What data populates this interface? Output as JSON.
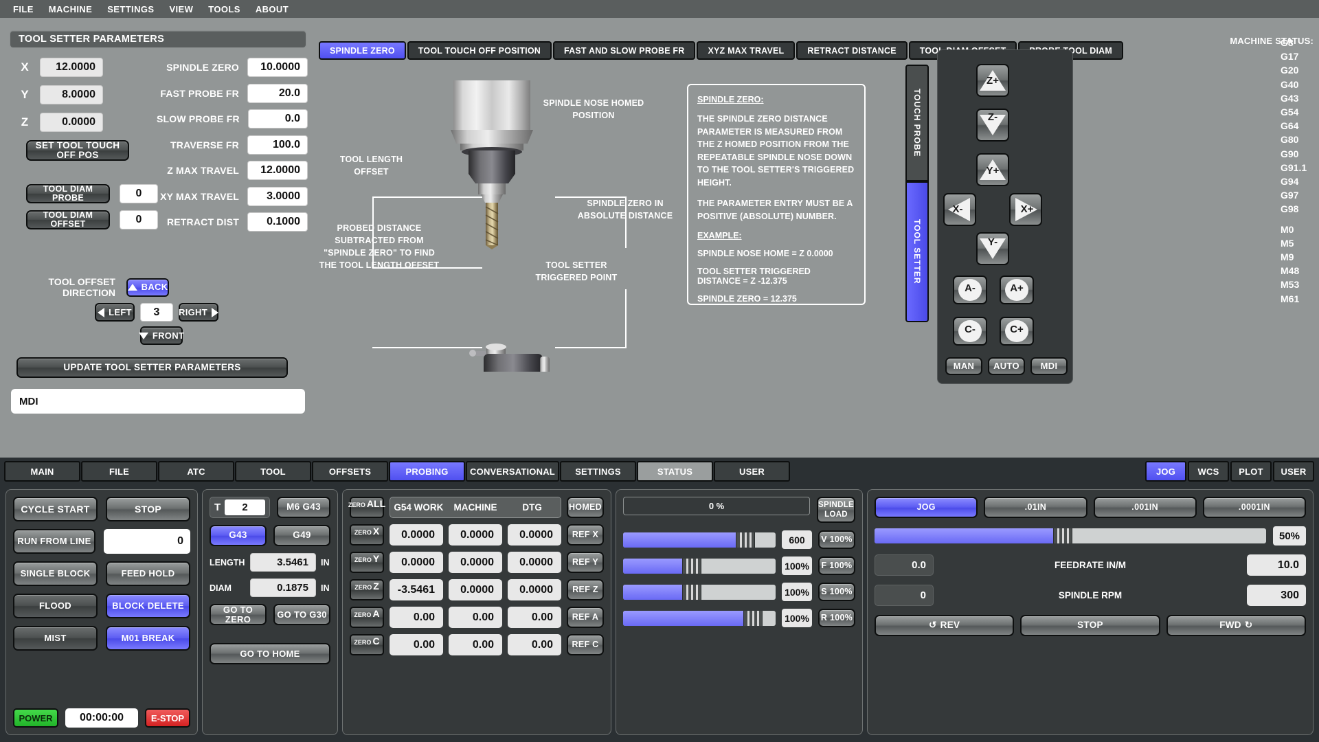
{
  "menubar": {
    "items": [
      "FILE",
      "MACHINE",
      "SETTINGS",
      "VIEW",
      "TOOLS",
      "ABOUT"
    ]
  },
  "left_panel": {
    "title": "TOOL SETTER PARAMETERS",
    "axes": [
      {
        "label": "X",
        "value": "12.0000"
      },
      {
        "label": "Y",
        "value": "8.0000"
      },
      {
        "label": "Z",
        "value": "0.0000"
      }
    ],
    "set_touch_off_label": "SET TOOL TOUCH OFF POS",
    "tool_diam_probe_label": "TOOL DIAM PROBE",
    "tool_diam_probe_value": "0",
    "tool_diam_offset_label": "TOOL DIAM OFFSET",
    "tool_diam_offset_value": "0",
    "params": [
      {
        "label": "SPINDLE ZERO",
        "value": "10.0000"
      },
      {
        "label": "FAST PROBE FR",
        "value": "20.0"
      },
      {
        "label": "SLOW PROBE FR",
        "value": "0.0"
      },
      {
        "label": "TRAVERSE FR",
        "value": "100.0"
      },
      {
        "label": "Z MAX TRAVEL",
        "value": "12.0000"
      },
      {
        "label": "XY MAX TRAVEL",
        "value": "3.0000"
      },
      {
        "label": "RETRACT DIST",
        "value": "0.1000"
      }
    ],
    "direction_label": "TOOL OFFSET DIRECTION",
    "dir_back": "BACK",
    "dir_left": "LEFT",
    "dir_right": "RIGHT",
    "dir_front": "FRONT",
    "dir_value": "3",
    "update_label": "UPDATE TOOL SETTER PARAMETERS",
    "mdi_value": "MDI",
    "mdi_placeholder": "MDI"
  },
  "probe_tabs": {
    "items": [
      "SPINDLE ZERO",
      "TOOL TOUCH OFF POSITION",
      "FAST AND SLOW PROBE FR",
      "XYZ MAX TRAVEL",
      "RETRACT DISTANCE",
      "TOOL DIAM OFFSET",
      "PROBE TOOL DIAM"
    ],
    "active": 0
  },
  "diagram": {
    "annotations": [
      "SPINDLE NOSE\nHOMED POSITION",
      "TOOL LENGTH\nOFFSET",
      "SPINDLE ZERO IN\nABSOLUTE DISTANCE",
      "PROBED DISTANCE\nSUBTRACTED FROM\n\"SPINDLE ZERO\" TO FIND\nTHE TOOL LENGTH OFFSET",
      "TOOL SETTER\nTRIGGERED POINT"
    ]
  },
  "info_box": {
    "heading": "SPINDLE ZERO:",
    "para1": "THE SPINDLE ZERO DISTANCE PARAMETER IS MEASURED FROM THE Z HOMED POSITION FROM THE REPEATABLE SPINDLE NOSE DOWN TO THE TOOL SETTER'S TRIGGERED HEIGHT.",
    "para2": "THE PARAMETER ENTRY MUST BE A POSITIVE (ABSOLUTE) NUMBER.",
    "example_heading": "EXAMPLE:",
    "ex1": "SPINDLE NOSE HOME = Z 0.0000",
    "ex2": "TOOL SETTER TRIGGERED DISTANCE = Z -12.375",
    "ex3": "SPINDLE ZERO = 12.375"
  },
  "vertical_tabs": {
    "probe": "TOUCH PROBE",
    "setter": "TOOL SETTER",
    "active": "setter"
  },
  "jog_pad": {
    "buttons": [
      "Z+",
      "Z-",
      "Y+",
      "X-",
      "X+",
      "Y-",
      "A-",
      "A+",
      "C-",
      "C+"
    ],
    "modes": [
      "MAN",
      "AUTO",
      "MDI"
    ],
    "active_mode": "MAN"
  },
  "machine_status": {
    "label": "MACHINE STATUS:",
    "gcodes": [
      "G8",
      "G17",
      "G20",
      "G40",
      "G43",
      "G54",
      "G64",
      "G80",
      "G90",
      "G91.1",
      "G94",
      "G97",
      "G98"
    ],
    "mcodes": [
      "M0",
      "M5",
      "M9",
      "M48",
      "M53",
      "M61"
    ]
  },
  "nav": {
    "tabs": [
      "MAIN",
      "FILE",
      "ATC",
      "TOOL",
      "OFFSETS",
      "PROBING",
      "CONVERSATIONAL",
      "SETTINGS",
      "STATUS",
      "USER"
    ],
    "active": "PROBING",
    "highlighted": "STATUS",
    "right_tabs": [
      "JOG",
      "WCS",
      "PLOT",
      "USER"
    ],
    "right_active": "JOG"
  },
  "control_panel": {
    "cycle_start": "CYCLE START",
    "stop": "STOP",
    "run_from_line": "RUN FROM LINE",
    "run_from_line_value": "0",
    "single_block": "SINGLE BLOCK",
    "feed_hold": "FEED HOLD",
    "flood": "FLOOD",
    "block_delete": "BLOCK DELETE",
    "mist": "MIST",
    "m01_break": "M01 BREAK",
    "power": "POWER",
    "clock": "00:00:00",
    "estop": "E-STOP"
  },
  "tool_panel": {
    "t_label": "T",
    "t_value": "2",
    "m6g43": "M6 G43",
    "g43": "G43",
    "g49": "G49",
    "length_label": "LENGTH",
    "length_value": "3.5461",
    "length_unit": "IN",
    "diam_label": "DIAM",
    "diam_value": "0.1875",
    "diam_unit": "IN",
    "go_to_zero": "GO TO ZERO",
    "go_to_g30": "GO TO G30",
    "go_to_home": "GO TO HOME"
  },
  "dro_panel": {
    "zero_all": {
      "small": "ZERO",
      "big": "ALL"
    },
    "headers": [
      "G54 WORK",
      "MACHINE",
      "DTG"
    ],
    "homed": "HOMED",
    "rows": [
      {
        "zero_small": "ZERO",
        "zero_big": "X",
        "work": "0.0000",
        "machine": "0.0000",
        "dtg": "0.0000",
        "ref": "REF X"
      },
      {
        "zero_small": "ZERO",
        "zero_big": "Y",
        "work": "0.0000",
        "machine": "0.0000",
        "dtg": "0.0000",
        "ref": "REF Y"
      },
      {
        "zero_small": "ZERO",
        "zero_big": "Z",
        "work": "-3.5461",
        "machine": "0.0000",
        "dtg": "0.0000",
        "ref": "REF Z"
      },
      {
        "zero_small": "ZERO",
        "zero_big": "A",
        "work": "0.00",
        "machine": "0.00",
        "dtg": "0.00",
        "ref": "REF A"
      },
      {
        "zero_small": "ZERO",
        "zero_big": "C",
        "work": "0.00",
        "machine": "0.00",
        "dtg": "0.00",
        "ref": "REF C"
      }
    ]
  },
  "override_panel": {
    "spindle_load_bar": "0 %",
    "spindle_load_btn": "SPINDLE\nLOAD",
    "rows": [
      {
        "value": "600",
        "btn": "V 100%",
        "fill_pct": 80
      },
      {
        "value": "100%",
        "btn": "F 100%",
        "fill_pct": 45
      },
      {
        "value": "100%",
        "btn": "S 100%",
        "fill_pct": 45
      },
      {
        "value": "100%",
        "btn": "R 100%",
        "fill_pct": 85
      }
    ]
  },
  "jog_panel": {
    "mode_buttons": [
      "JOG",
      ".01IN",
      ".001IN",
      ".0001IN"
    ],
    "mode_active": "JOG",
    "rate_pct": "50%",
    "rate_fill_pct": 48,
    "feedrate_actual": "0.0",
    "feedrate_label": "FEEDRATE IN/M",
    "feedrate_value": "10.0",
    "spindle_actual": "0",
    "spindle_label": "SPINDLE RPM",
    "spindle_value": "300",
    "rev": "REV",
    "stop": "STOP",
    "fwd": "FWD",
    "rev_icon": "↺",
    "fwd_icon": "↻"
  },
  "colors": {
    "accent_blue": "#5b5bf2",
    "panel_grey": "#929696",
    "dark_bg": "#2b3033",
    "power_green": "#22b42a",
    "estop_red": "#d42222"
  }
}
